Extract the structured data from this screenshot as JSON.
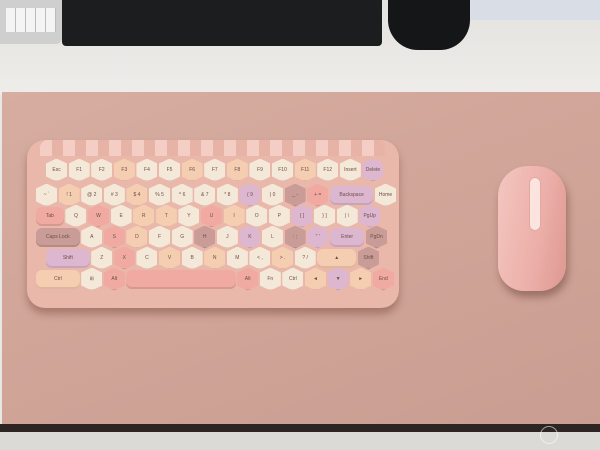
{
  "scene": "keyboard-and-mouse-on-desk-mat",
  "colors": {
    "mat": "#d3a89b",
    "keyboard_body": "#eab7ab",
    "mouse": "#efb6b0",
    "key_palette": [
      "#f4e8d9",
      "#f5cdb0",
      "#f0aaa2",
      "#ddb7cf",
      "#c99c97"
    ]
  },
  "keyboard": {
    "rows": [
      [
        [
          "Esc",
          0
        ],
        [
          "F1",
          0
        ],
        [
          "F2",
          0
        ],
        [
          "F3",
          1
        ],
        [
          "F4",
          0
        ],
        [
          "F5",
          0
        ],
        [
          "F6",
          1
        ],
        [
          "F7",
          0
        ],
        [
          "F8",
          1
        ],
        [
          "F9",
          0
        ],
        [
          "F10",
          0
        ],
        [
          "F11",
          1
        ],
        [
          "F12",
          0
        ],
        [
          "Insert",
          0
        ],
        [
          "Delete",
          3
        ]
      ],
      [
        [
          "~ `",
          0
        ],
        [
          "! 1",
          1
        ],
        [
          "@ 2",
          0
        ],
        [
          "# 3",
          0
        ],
        [
          "$ 4",
          1
        ],
        [
          "% 5",
          0
        ],
        [
          "^ 6",
          0
        ],
        [
          "& 7",
          0
        ],
        [
          "* 8",
          0
        ],
        [
          "( 9",
          3
        ],
        [
          ") 0",
          0
        ],
        [
          "_ -",
          4
        ],
        [
          "+ =",
          2
        ],
        [
          "Backspace",
          3
        ],
        [
          "Home",
          0
        ]
      ],
      [
        [
          "Tab",
          2
        ],
        [
          "Q",
          0
        ],
        [
          "W",
          2
        ],
        [
          "E",
          0
        ],
        [
          "R",
          1
        ],
        [
          "T",
          1
        ],
        [
          "Y",
          0
        ],
        [
          "U",
          2
        ],
        [
          "I",
          1
        ],
        [
          "O",
          0
        ],
        [
          "P",
          0
        ],
        [
          "{ [",
          3
        ],
        [
          "} ]",
          0
        ],
        [
          "| \\",
          0
        ],
        [
          "PgUp",
          3
        ]
      ],
      [
        [
          "Caps Lock",
          4
        ],
        [
          "A",
          0
        ],
        [
          "S",
          2
        ],
        [
          "D",
          1
        ],
        [
          "F",
          0
        ],
        [
          "G",
          0
        ],
        [
          "H",
          4
        ],
        [
          "J",
          0
        ],
        [
          "K",
          3
        ],
        [
          "L",
          0
        ],
        [
          ": ;",
          4
        ],
        [
          "\" '",
          3
        ],
        [
          "Enter",
          3
        ],
        [
          "PgDn",
          4
        ]
      ],
      [
        [
          "Shift",
          3
        ],
        [
          "Z",
          0
        ],
        [
          "X",
          2
        ],
        [
          "C",
          0
        ],
        [
          "V",
          1
        ],
        [
          "B",
          0
        ],
        [
          "N",
          1
        ],
        [
          "M",
          0
        ],
        [
          "< ,",
          0
        ],
        [
          "> .",
          1
        ],
        [
          "? /",
          0
        ],
        [
          "▲",
          1
        ],
        [
          "Shift",
          4
        ]
      ],
      [
        [
          "Ctrl",
          1
        ],
        [
          "⊞",
          0
        ],
        [
          "Alt",
          2
        ],
        [
          "",
          2
        ],
        [
          "Alt",
          2
        ],
        [
          "Fn",
          0
        ],
        [
          "Ctrl",
          0
        ],
        [
          "◄",
          1
        ],
        [
          "▼",
          3
        ],
        [
          "►",
          1
        ],
        [
          "End",
          2
        ]
      ]
    ]
  },
  "watermark": "logo watermark"
}
